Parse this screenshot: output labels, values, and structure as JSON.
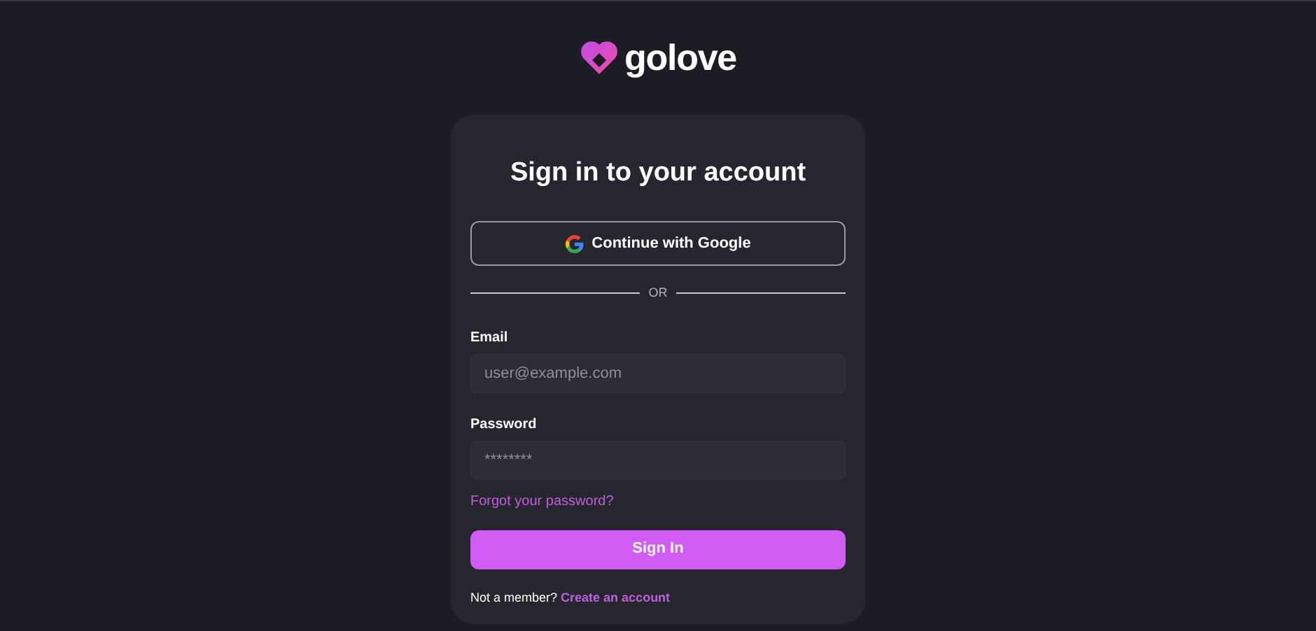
{
  "logo": {
    "text": "golove"
  },
  "title": "Sign in to your account",
  "google_button": {
    "label": "Continue with Google"
  },
  "divider": {
    "label": "OR"
  },
  "fields": [
    {
      "label": "Email",
      "placeholder": "user@example.com"
    },
    {
      "label": "Password",
      "placeholder": "********"
    }
  ],
  "forgot_link": "Forgot your password?",
  "submit_button": "Sign In",
  "signup": {
    "prompt": "Not a member? ",
    "link": "Create an account"
  }
}
